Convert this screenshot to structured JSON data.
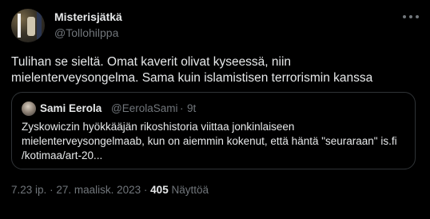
{
  "author": {
    "display_name": "Misterisjätkä",
    "handle": "@Tollohilppa"
  },
  "tweet": {
    "text": "Tulihan se sieltä. Omat kaverit olivat kyseessä, niin mielenterveysongelma. Sama kuin islamistisen terrorismin kanssa"
  },
  "quoted": {
    "display_name": "Sami Eerola",
    "handle": "@EerolaSami",
    "separator": "·",
    "time": "9t",
    "text": "Zyskowiczin hyökkääjän rikoshistoria viittaa jonkinlaiseen mielenterveysongelmaab, kun on aiemmin kokenut, että häntä \"seuraraan\" is.fi /kotimaa/art-20..."
  },
  "meta": {
    "time": "7.23 ip.",
    "separator1": "·",
    "date": "27. maalisk. 2023",
    "separator2": "·",
    "views_count": "405",
    "views_label": "Näyttöä"
  },
  "icons": {
    "more": "more-horizontal-icon"
  },
  "colors": {
    "background": "#000000",
    "text_primary": "#e7e9ea",
    "text_secondary": "#71767b",
    "border": "#2f3336"
  }
}
